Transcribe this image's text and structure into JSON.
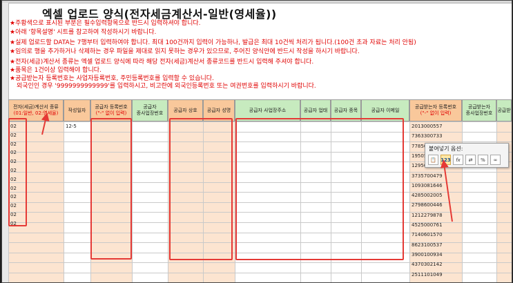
{
  "title": "엑셀 업로드 양식(전자세금계산서-일반(영세율))",
  "notes": [
    "★주황색으로 표시된 부분은 필수입력항목으로 반드시 입력하셔야 합니다.",
    "★아래 '항목설명' 시트를 참고하여 작성하시기 바랍니다.",
    "★실제 업로드할 DATA는 7행부터 입력하여야 합니다. 최대 100건까지 입력이 가능하나, 발급은 최대 10건씩 처리가 됩니다.(100건 초과 자료는 처리 안됨)",
    "★임의로 행을 추가하거나 삭제하는 경우 파일을 제대로 읽지 못하는 경우가 있으므로, 주어진 양식안에 반드시 작성을 하시기 바랍니다.",
    "★전자(세금)계산서 종류는 엑셀 업로드 양식에 따라 해당 전자(세금)계산서 종류코드를 반드시 입력해 주셔야 합니다.",
    "★품목은 1건이상 입력해야 합니다.",
    "★공급받는자 등록번호는 사업자등록번호, 주민등록번호를 입력할 수 있습니다.",
    "외국인인 경우 '9999999999999'를 입력하시고, 비고란에 외국인등록번호 또는 여권번호를 입력하시기 바랍니다."
  ],
  "headers": [
    {
      "label": "전자(세금)계산서 종류",
      "sub": "(01:일반, 02:영세율)"
    },
    {
      "label": "작성일자",
      "sub": ""
    },
    {
      "label": "공급자 등록번호",
      "sub": "(\"-\" 없이 입력)"
    },
    {
      "label": "공급자",
      "sub": "종사업장번호"
    },
    {
      "label": "공급자 상호",
      "sub": ""
    },
    {
      "label": "공급자 성명",
      "sub": ""
    },
    {
      "label": "공급자 사업장주소",
      "sub": ""
    },
    {
      "label": "공급자 업태",
      "sub": ""
    },
    {
      "label": "공급자 종목",
      "sub": ""
    },
    {
      "label": "공급자 이메일",
      "sub": ""
    },
    {
      "label": "공급받는자 등록번호",
      "sub": "(\"-\" 없이 입력)"
    },
    {
      "label": "공급받는자",
      "sub": "종사업장번호"
    },
    {
      "label": "공급받",
      "sub": ""
    }
  ],
  "type_codes": [
    "02",
    "02",
    "02",
    "02",
    "02",
    "02",
    "02",
    "02",
    "02",
    "02",
    "02",
    "02"
  ],
  "date_value": "12-5",
  "recipient_ids": [
    "2013000557",
    "7363300733",
    "77850",
    "195050",
    "129500",
    "3735700479",
    "1093081646",
    "4285002005",
    "2798600446",
    "1212279878",
    "4525000761",
    "7140601570",
    "8623100537",
    "3900100934",
    "4370302142",
    "2511101049"
  ],
  "paste_popup": {
    "label": "붙여넣기 옵션:",
    "buttons": [
      {
        "name": "paste-default-icon",
        "glyph": "📋"
      },
      {
        "name": "paste-values-icon",
        "glyph": "123"
      },
      {
        "name": "paste-formulas-icon",
        "glyph": "fx"
      },
      {
        "name": "paste-formatting-icon",
        "glyph": "⇄"
      },
      {
        "name": "paste-number-format-icon",
        "glyph": "%"
      },
      {
        "name": "paste-link-icon",
        "glyph": "∞"
      }
    ]
  },
  "colors": {
    "required": "#f9c89b",
    "optional": "#c7ebbf",
    "highlight": "#e53935",
    "note_text": "#e00000"
  }
}
